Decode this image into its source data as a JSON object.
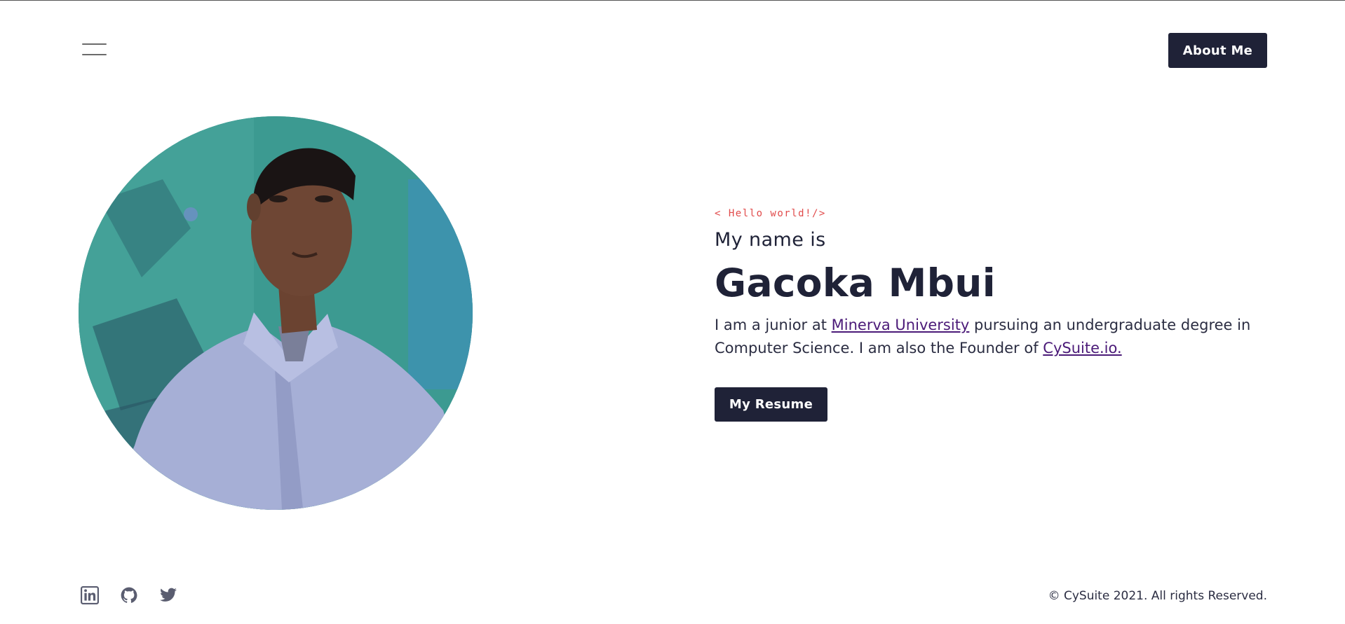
{
  "nav": {
    "menu_icon": "hamburger-menu-icon",
    "about_label": "About Me"
  },
  "hero": {
    "greeting": "< Hello world!/>",
    "intro": "My name is",
    "name": "Gacoka Mbui",
    "bio": {
      "prefix": "I am a junior at ",
      "university_link": "Minerva University",
      "middle": " pursuing an undergraduate degree in Computer Science. I am also the Founder of ",
      "company_link": "CySuite.io."
    },
    "resume_label": "My Resume"
  },
  "footer": {
    "social_icons": [
      "linkedin-icon",
      "github-icon",
      "twitter-icon"
    ],
    "copyright": "© CySuite 2021. All rights Reserved."
  },
  "colors": {
    "primary": "#1f2237",
    "accent_greeting": "#e14b4b",
    "link": "#4b1a78"
  }
}
